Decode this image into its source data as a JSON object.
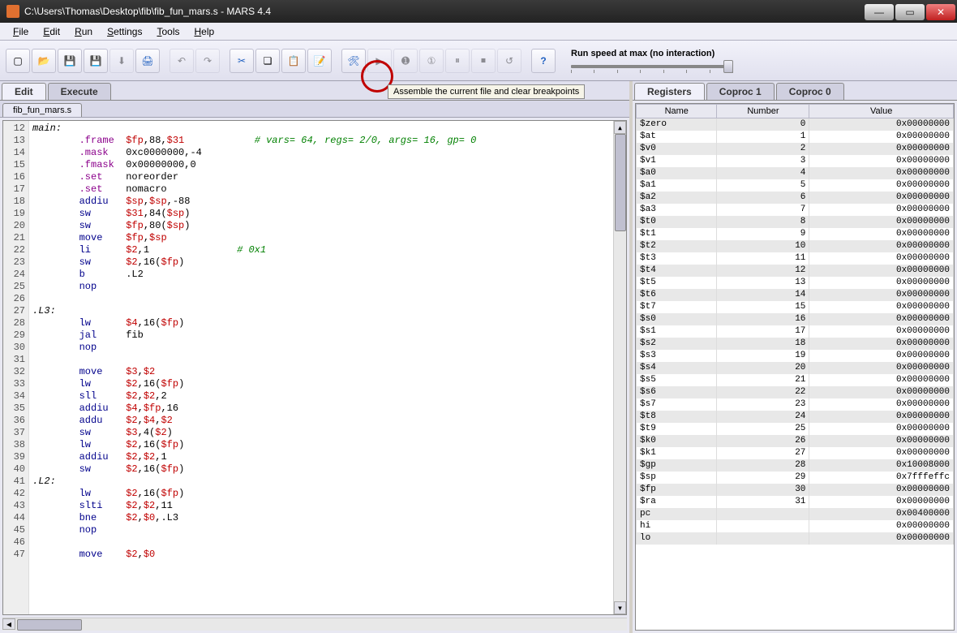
{
  "window": {
    "title": "C:\\Users\\Thomas\\Desktop\\fib\\fib_fun_mars.s  -  MARS 4.4"
  },
  "menu": [
    "File",
    "Edit",
    "Run",
    "Settings",
    "Tools",
    "Help"
  ],
  "toolbar": {
    "tooltip": "Assemble the current file and clear breakpoints",
    "slider_label": "Run speed at max (no interaction)"
  },
  "left_tabs": {
    "items": [
      "Edit",
      "Execute"
    ],
    "active": 0
  },
  "file_tab": "fib_fun_mars.s",
  "code_start_line": 12,
  "code_lines": [
    [
      [
        "label",
        "main:"
      ]
    ],
    [
      [
        "pad",
        "        "
      ],
      [
        "dir",
        ".frame"
      ],
      [
        "pad",
        "  "
      ],
      [
        "reg",
        "$fp"
      ],
      [
        "text",
        ",88,"
      ],
      [
        "reg",
        "$31"
      ],
      [
        "pad",
        "            "
      ],
      [
        "comment",
        "# vars= 64, regs= 2/0, args= 16, gp= 0"
      ]
    ],
    [
      [
        "pad",
        "        "
      ],
      [
        "dir",
        ".mask"
      ],
      [
        "pad",
        "   "
      ],
      [
        "text",
        "0xc0000000,-4"
      ]
    ],
    [
      [
        "pad",
        "        "
      ],
      [
        "dir",
        ".fmask"
      ],
      [
        "pad",
        "  "
      ],
      [
        "text",
        "0x00000000,0"
      ]
    ],
    [
      [
        "pad",
        "        "
      ],
      [
        "dir",
        ".set"
      ],
      [
        "pad",
        "    "
      ],
      [
        "text",
        "noreorder"
      ]
    ],
    [
      [
        "pad",
        "        "
      ],
      [
        "dir",
        ".set"
      ],
      [
        "pad",
        "    "
      ],
      [
        "text",
        "nomacro"
      ]
    ],
    [
      [
        "pad",
        "        "
      ],
      [
        "op",
        "addiu"
      ],
      [
        "pad",
        "   "
      ],
      [
        "reg",
        "$sp"
      ],
      [
        "text",
        ","
      ],
      [
        "reg",
        "$sp"
      ],
      [
        "text",
        ",-88"
      ]
    ],
    [
      [
        "pad",
        "        "
      ],
      [
        "op",
        "sw"
      ],
      [
        "pad",
        "      "
      ],
      [
        "reg",
        "$31"
      ],
      [
        "text",
        ",84("
      ],
      [
        "reg",
        "$sp"
      ],
      [
        "text",
        ")"
      ]
    ],
    [
      [
        "pad",
        "        "
      ],
      [
        "op",
        "sw"
      ],
      [
        "pad",
        "      "
      ],
      [
        "reg",
        "$fp"
      ],
      [
        "text",
        ",80("
      ],
      [
        "reg",
        "$sp"
      ],
      [
        "text",
        ")"
      ]
    ],
    [
      [
        "pad",
        "        "
      ],
      [
        "op",
        "move"
      ],
      [
        "pad",
        "    "
      ],
      [
        "reg",
        "$fp"
      ],
      [
        "text",
        ","
      ],
      [
        "reg",
        "$sp"
      ]
    ],
    [
      [
        "pad",
        "        "
      ],
      [
        "op",
        "li"
      ],
      [
        "pad",
        "      "
      ],
      [
        "reg",
        "$2"
      ],
      [
        "text",
        ",1"
      ],
      [
        "pad",
        "               "
      ],
      [
        "comment",
        "# 0x1"
      ]
    ],
    [
      [
        "pad",
        "        "
      ],
      [
        "op",
        "sw"
      ],
      [
        "pad",
        "      "
      ],
      [
        "reg",
        "$2"
      ],
      [
        "text",
        ",16("
      ],
      [
        "reg",
        "$fp"
      ],
      [
        "text",
        ")"
      ]
    ],
    [
      [
        "pad",
        "        "
      ],
      [
        "op",
        "b"
      ],
      [
        "pad",
        "       "
      ],
      [
        "text",
        ".L2"
      ]
    ],
    [
      [
        "pad",
        "        "
      ],
      [
        "op",
        "nop"
      ]
    ],
    [],
    [
      [
        "label",
        ".L3:"
      ]
    ],
    [
      [
        "pad",
        "        "
      ],
      [
        "op",
        "lw"
      ],
      [
        "pad",
        "      "
      ],
      [
        "reg",
        "$4"
      ],
      [
        "text",
        ",16("
      ],
      [
        "reg",
        "$fp"
      ],
      [
        "text",
        ")"
      ]
    ],
    [
      [
        "pad",
        "        "
      ],
      [
        "op",
        "jal"
      ],
      [
        "pad",
        "     "
      ],
      [
        "text",
        "fib"
      ]
    ],
    [
      [
        "pad",
        "        "
      ],
      [
        "op",
        "nop"
      ]
    ],
    [],
    [
      [
        "pad",
        "        "
      ],
      [
        "op",
        "move"
      ],
      [
        "pad",
        "    "
      ],
      [
        "reg",
        "$3"
      ],
      [
        "text",
        ","
      ],
      [
        "reg",
        "$2"
      ]
    ],
    [
      [
        "pad",
        "        "
      ],
      [
        "op",
        "lw"
      ],
      [
        "pad",
        "      "
      ],
      [
        "reg",
        "$2"
      ],
      [
        "text",
        ",16("
      ],
      [
        "reg",
        "$fp"
      ],
      [
        "text",
        ")"
      ]
    ],
    [
      [
        "pad",
        "        "
      ],
      [
        "op",
        "sll"
      ],
      [
        "pad",
        "     "
      ],
      [
        "reg",
        "$2"
      ],
      [
        "text",
        ","
      ],
      [
        "reg",
        "$2"
      ],
      [
        "text",
        ",2"
      ]
    ],
    [
      [
        "pad",
        "        "
      ],
      [
        "op",
        "addiu"
      ],
      [
        "pad",
        "   "
      ],
      [
        "reg",
        "$4"
      ],
      [
        "text",
        ","
      ],
      [
        "reg",
        "$fp"
      ],
      [
        "text",
        ",16"
      ]
    ],
    [
      [
        "pad",
        "        "
      ],
      [
        "op",
        "addu"
      ],
      [
        "pad",
        "    "
      ],
      [
        "reg",
        "$2"
      ],
      [
        "text",
        ","
      ],
      [
        "reg",
        "$4"
      ],
      [
        "text",
        ","
      ],
      [
        "reg",
        "$2"
      ]
    ],
    [
      [
        "pad",
        "        "
      ],
      [
        "op",
        "sw"
      ],
      [
        "pad",
        "      "
      ],
      [
        "reg",
        "$3"
      ],
      [
        "text",
        ",4("
      ],
      [
        "reg",
        "$2"
      ],
      [
        "text",
        ")"
      ]
    ],
    [
      [
        "pad",
        "        "
      ],
      [
        "op",
        "lw"
      ],
      [
        "pad",
        "      "
      ],
      [
        "reg",
        "$2"
      ],
      [
        "text",
        ",16("
      ],
      [
        "reg",
        "$fp"
      ],
      [
        "text",
        ")"
      ]
    ],
    [
      [
        "pad",
        "        "
      ],
      [
        "op",
        "addiu"
      ],
      [
        "pad",
        "   "
      ],
      [
        "reg",
        "$2"
      ],
      [
        "text",
        ","
      ],
      [
        "reg",
        "$2"
      ],
      [
        "text",
        ",1"
      ]
    ],
    [
      [
        "pad",
        "        "
      ],
      [
        "op",
        "sw"
      ],
      [
        "pad",
        "      "
      ],
      [
        "reg",
        "$2"
      ],
      [
        "text",
        ",16("
      ],
      [
        "reg",
        "$fp"
      ],
      [
        "text",
        ")"
      ]
    ],
    [
      [
        "label",
        ".L2:"
      ]
    ],
    [
      [
        "pad",
        "        "
      ],
      [
        "op",
        "lw"
      ],
      [
        "pad",
        "      "
      ],
      [
        "reg",
        "$2"
      ],
      [
        "text",
        ",16("
      ],
      [
        "reg",
        "$fp"
      ],
      [
        "text",
        ")"
      ]
    ],
    [
      [
        "pad",
        "        "
      ],
      [
        "op",
        "slti"
      ],
      [
        "pad",
        "    "
      ],
      [
        "reg",
        "$2"
      ],
      [
        "text",
        ","
      ],
      [
        "reg",
        "$2"
      ],
      [
        "text",
        ",11"
      ]
    ],
    [
      [
        "pad",
        "        "
      ],
      [
        "op",
        "bne"
      ],
      [
        "pad",
        "     "
      ],
      [
        "reg",
        "$2"
      ],
      [
        "text",
        ","
      ],
      [
        "reg",
        "$0"
      ],
      [
        "text",
        ",.L3"
      ]
    ],
    [
      [
        "pad",
        "        "
      ],
      [
        "op",
        "nop"
      ]
    ],
    [],
    [
      [
        "pad",
        "        "
      ],
      [
        "op",
        "move"
      ],
      [
        "pad",
        "    "
      ],
      [
        "reg",
        "$2"
      ],
      [
        "text",
        ","
      ],
      [
        "reg",
        "$0"
      ]
    ]
  ],
  "right_tabs": {
    "items": [
      "Registers",
      "Coproc 1",
      "Coproc 0"
    ],
    "active": 0
  },
  "reg_headers": [
    "Name",
    "Number",
    "Value"
  ],
  "registers": [
    {
      "name": "$zero",
      "num": "0",
      "val": "0x00000000"
    },
    {
      "name": "$at",
      "num": "1",
      "val": "0x00000000"
    },
    {
      "name": "$v0",
      "num": "2",
      "val": "0x00000000"
    },
    {
      "name": "$v1",
      "num": "3",
      "val": "0x00000000"
    },
    {
      "name": "$a0",
      "num": "4",
      "val": "0x00000000"
    },
    {
      "name": "$a1",
      "num": "5",
      "val": "0x00000000"
    },
    {
      "name": "$a2",
      "num": "6",
      "val": "0x00000000"
    },
    {
      "name": "$a3",
      "num": "7",
      "val": "0x00000000"
    },
    {
      "name": "$t0",
      "num": "8",
      "val": "0x00000000"
    },
    {
      "name": "$t1",
      "num": "9",
      "val": "0x00000000"
    },
    {
      "name": "$t2",
      "num": "10",
      "val": "0x00000000"
    },
    {
      "name": "$t3",
      "num": "11",
      "val": "0x00000000"
    },
    {
      "name": "$t4",
      "num": "12",
      "val": "0x00000000"
    },
    {
      "name": "$t5",
      "num": "13",
      "val": "0x00000000"
    },
    {
      "name": "$t6",
      "num": "14",
      "val": "0x00000000"
    },
    {
      "name": "$t7",
      "num": "15",
      "val": "0x00000000"
    },
    {
      "name": "$s0",
      "num": "16",
      "val": "0x00000000"
    },
    {
      "name": "$s1",
      "num": "17",
      "val": "0x00000000"
    },
    {
      "name": "$s2",
      "num": "18",
      "val": "0x00000000"
    },
    {
      "name": "$s3",
      "num": "19",
      "val": "0x00000000"
    },
    {
      "name": "$s4",
      "num": "20",
      "val": "0x00000000"
    },
    {
      "name": "$s5",
      "num": "21",
      "val": "0x00000000"
    },
    {
      "name": "$s6",
      "num": "22",
      "val": "0x00000000"
    },
    {
      "name": "$s7",
      "num": "23",
      "val": "0x00000000"
    },
    {
      "name": "$t8",
      "num": "24",
      "val": "0x00000000"
    },
    {
      "name": "$t9",
      "num": "25",
      "val": "0x00000000"
    },
    {
      "name": "$k0",
      "num": "26",
      "val": "0x00000000"
    },
    {
      "name": "$k1",
      "num": "27",
      "val": "0x00000000"
    },
    {
      "name": "$gp",
      "num": "28",
      "val": "0x10008000"
    },
    {
      "name": "$sp",
      "num": "29",
      "val": "0x7fffeffc"
    },
    {
      "name": "$fp",
      "num": "30",
      "val": "0x00000000"
    },
    {
      "name": "$ra",
      "num": "31",
      "val": "0x00000000"
    },
    {
      "name": "pc",
      "num": "",
      "val": "0x00400000"
    },
    {
      "name": "hi",
      "num": "",
      "val": "0x00000000"
    },
    {
      "name": "lo",
      "num": "",
      "val": "0x00000000"
    }
  ],
  "icons": {
    "new": "📄",
    "open": "📂",
    "save": "💾",
    "saveas": "💾",
    "dump": "⬇",
    "print": "🖨",
    "undo": "↶",
    "redo": "↷",
    "cut": "✂",
    "copy": "📋",
    "paste": "📋",
    "find": "🔍",
    "assemble": "🔧",
    "run": "▶",
    "step": "➡",
    "back": "⬅",
    "pause": "⏸",
    "stop": "⏹",
    "reset": "↺",
    "help": "?"
  }
}
